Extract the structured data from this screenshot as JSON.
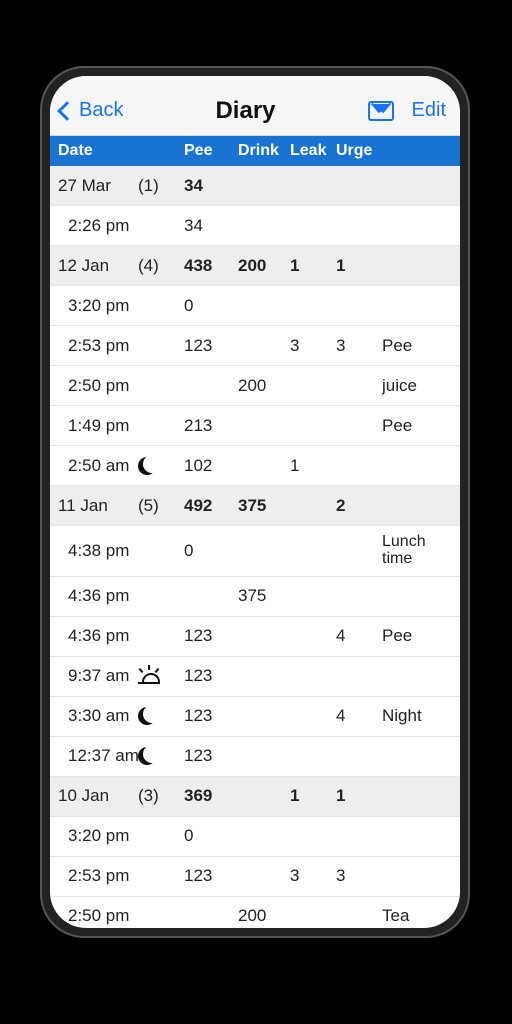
{
  "nav": {
    "back": "Back",
    "title": "Diary",
    "edit": "Edit"
  },
  "columns": {
    "date": "Date",
    "pee": "Pee",
    "drink": "Drink",
    "leak": "Leak",
    "urge": "Urge"
  },
  "rows": [
    {
      "type": "summary",
      "date": "27 Mar",
      "count": "(1)",
      "pee": "34",
      "drink": "",
      "leak": "",
      "urge": "",
      "note": ""
    },
    {
      "type": "entry",
      "date": "2:26 pm",
      "icon": "",
      "pee": "34",
      "drink": "",
      "leak": "",
      "urge": "",
      "note": ""
    },
    {
      "type": "summary",
      "date": "12 Jan",
      "count": "(4)",
      "pee": "438",
      "drink": "200",
      "leak": "1",
      "urge": "1",
      "note": ""
    },
    {
      "type": "entry",
      "date": "3:20 pm",
      "icon": "",
      "pee": "0",
      "drink": "",
      "leak": "",
      "urge": "",
      "note": ""
    },
    {
      "type": "entry",
      "date": "2:53 pm",
      "icon": "",
      "pee": "123",
      "drink": "",
      "leak": "3",
      "urge": "3",
      "note": "Pee"
    },
    {
      "type": "entry",
      "date": "2:50 pm",
      "icon": "",
      "pee": "",
      "drink": "200",
      "leak": "",
      "urge": "",
      "note": "juice"
    },
    {
      "type": "entry",
      "date": "1:49 pm",
      "icon": "",
      "pee": "213",
      "drink": "",
      "leak": "",
      "urge": "",
      "note": "Pee"
    },
    {
      "type": "entry",
      "date": "2:50 am",
      "icon": "moon",
      "pee": "102",
      "drink": "",
      "leak": "1",
      "urge": "",
      "note": ""
    },
    {
      "type": "summary",
      "date": "11 Jan",
      "count": "(5)",
      "pee": "492",
      "drink": "375",
      "leak": "",
      "urge": "2",
      "note": ""
    },
    {
      "type": "entry",
      "date": "4:38 pm",
      "icon": "",
      "pee": "0",
      "drink": "",
      "leak": "",
      "urge": "",
      "note": "Lunch time"
    },
    {
      "type": "entry",
      "date": "4:36 pm",
      "icon": "",
      "pee": "",
      "drink": "375",
      "leak": "",
      "urge": "",
      "note": ""
    },
    {
      "type": "entry",
      "date": "4:36 pm",
      "icon": "",
      "pee": "123",
      "drink": "",
      "leak": "",
      "urge": "4",
      "note": "Pee"
    },
    {
      "type": "entry",
      "date": "9:37 am",
      "icon": "sunrise",
      "pee": "123",
      "drink": "",
      "leak": "",
      "urge": "",
      "note": ""
    },
    {
      "type": "entry",
      "date": "3:30 am",
      "icon": "moon",
      "pee": "123",
      "drink": "",
      "leak": "",
      "urge": "4",
      "note": "Night"
    },
    {
      "type": "entry",
      "date": "12:37 am",
      "icon": "moon",
      "pee": "123",
      "drink": "",
      "leak": "",
      "urge": "",
      "note": ""
    },
    {
      "type": "summary",
      "date": "10 Jan",
      "count": "(3)",
      "pee": "369",
      "drink": "",
      "leak": "1",
      "urge": "1",
      "note": ""
    },
    {
      "type": "entry",
      "date": "3:20 pm",
      "icon": "",
      "pee": "0",
      "drink": "",
      "leak": "",
      "urge": "",
      "note": ""
    },
    {
      "type": "entry",
      "date": "2:53 pm",
      "icon": "",
      "pee": "123",
      "drink": "",
      "leak": "3",
      "urge": "3",
      "note": ""
    },
    {
      "type": "entry",
      "date": "2:50 pm",
      "icon": "",
      "pee": "",
      "drink": "200",
      "leak": "",
      "urge": "",
      "note": "Tea"
    }
  ]
}
